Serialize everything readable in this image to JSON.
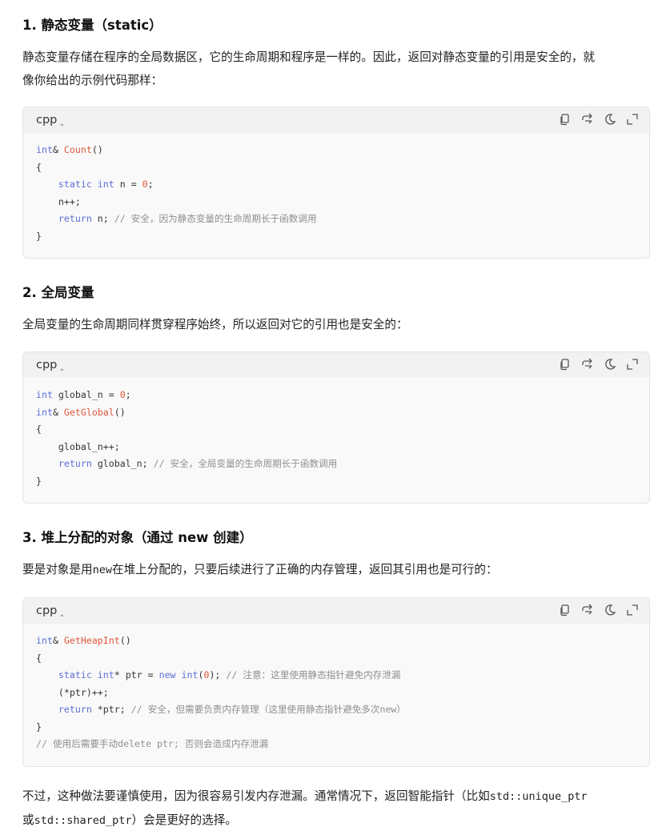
{
  "sections": [
    {
      "heading": "1. 静态变量（static）",
      "para_line1": "静态变量存储在程序的全局数据区，它的生命周期和程序是一样的。因此，返回对静态变量的引用是安全的，就",
      "para_line2": "像你给出的示例代码那样：",
      "lang": "cpp"
    },
    {
      "heading": "2. 全局变量",
      "para_line1": "全局变量的生命周期同样贯穿程序始终，所以返回对它的引用也是安全的：",
      "lang": "cpp"
    },
    {
      "heading": "3. 堆上分配的对象（通过 new 创建）",
      "para_pre": "要是对象是用",
      "para_code": "new",
      "para_post": "在堆上分配的，只要后续进行了正确的内存管理，返回其引用也是可行的：",
      "lang": "cpp"
    }
  ],
  "code1": {
    "l1_type": "int",
    "l1_amp": "& ",
    "l1_fn": "Count",
    "l1_paren": "()",
    "l2": "{",
    "l3_indent": "    ",
    "l3_kw1": "static",
    "l3_sp1": " ",
    "l3_kw2": "int",
    "l3_mid": " n = ",
    "l3_num": "0",
    "l3_end": ";",
    "l4": "    n++;",
    "l5_indent": "    ",
    "l5_kw": "return",
    "l5_mid": " n; ",
    "l5_cm": "// 安全，因为静态变量的生命周期长于函数调用",
    "l6": "}"
  },
  "code2": {
    "l1_kw": "int",
    "l1_mid": " global_n = ",
    "l1_num": "0",
    "l1_end": ";",
    "l2_type": "int",
    "l2_amp": "& ",
    "l2_fn": "GetGlobal",
    "l2_paren": "()",
    "l3": "{",
    "l4": "    global_n++;",
    "l5_indent": "    ",
    "l5_kw": "return",
    "l5_mid": " global_n; ",
    "l5_cm": "// 安全，全局变量的生命周期长于函数调用",
    "l6": "}"
  },
  "code3": {
    "l1_type": "int",
    "l1_amp": "& ",
    "l1_fn": "GetHeapInt",
    "l1_paren": "()",
    "l2": "{",
    "l3_indent": "    ",
    "l3_kw1": "static",
    "l3_sp1": " ",
    "l3_kw2": "int",
    "l3_mid1": "* ptr = ",
    "l3_kw3": "new",
    "l3_sp2": " ",
    "l3_kw4": "int",
    "l3_p1": "(",
    "l3_num": "0",
    "l3_p2": "); ",
    "l3_cm": "// 注意：这里使用静态指针避免内存泄漏",
    "l4": "    (*ptr)++;",
    "l5_indent": "    ",
    "l5_kw": "return",
    "l5_mid": " *ptr; ",
    "l5_cm": "// 安全，但需要负责内存管理（这里使用静态指针避免多次new）",
    "l6": "}",
    "l7_cm": "// 使用后需要手动delete ptr; 否则会造成内存泄漏"
  },
  "closing": {
    "line1_pre": "不过，这种做法要谨慎使用，因为很容易引发内存泄漏。通常情况下，返回智能指针（比如",
    "line1_code": "std::unique_ptr",
    "line2_pre": "或",
    "line2_code": "std::shared_ptr",
    "line2_post": "）会是更好的选择。"
  },
  "toolbar_icons": [
    "copy-icon",
    "wrap-icon",
    "theme-icon",
    "expand-icon"
  ],
  "colors": {
    "keyword": "#5a6fd6",
    "function": "#e0573a",
    "number": "#e0573a",
    "comment": "#8f8f8f",
    "code_bg": "#f9f9f9",
    "header_bg": "#f2f2f2"
  }
}
